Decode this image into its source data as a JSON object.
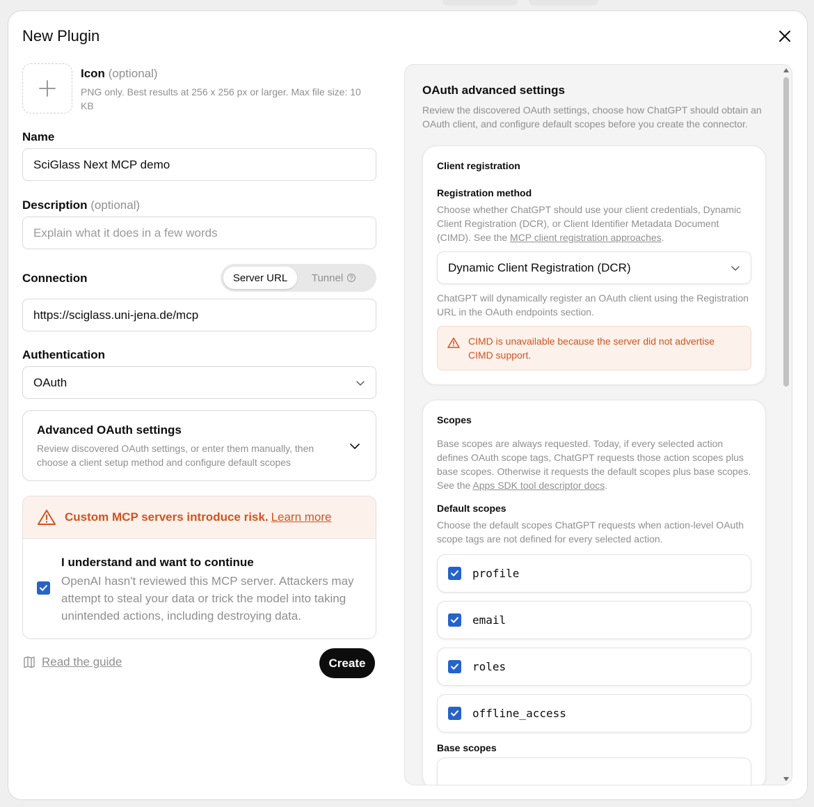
{
  "dialog": {
    "title": "New Plugin"
  },
  "icon_field": {
    "title": "Icon",
    "optional": "(optional)",
    "help": "PNG only. Best results at 256 x 256 px or larger. Max file size: 10 KB"
  },
  "name_field": {
    "label": "Name",
    "value": "SciGlass Next MCP demo"
  },
  "description_field": {
    "label": "Description",
    "optional": "(optional)",
    "placeholder": "Explain what it does in a few words"
  },
  "connection": {
    "label": "Connection",
    "options": [
      "Server URL",
      "Tunnel"
    ],
    "selected": "Server URL",
    "value": "https://sciglass.uni-jena.de/mcp"
  },
  "authentication": {
    "label": "Authentication",
    "value": "OAuth"
  },
  "advanced_oauth": {
    "title": "Advanced OAuth settings",
    "description": "Review discovered OAuth settings, or enter them manually, then choose a client setup method and configure default scopes"
  },
  "risk": {
    "headline": "Custom MCP servers introduce risk.",
    "link": "Learn more",
    "ack_title": "I understand and want to continue",
    "ack_desc": "OpenAI hasn't reviewed this MCP server. Attackers may attempt to steal your data or trick the model into taking unintended actions, including destroying data.",
    "ack_checked": true
  },
  "footer": {
    "guide": "Read the guide",
    "create": "Create"
  },
  "oauth_panel": {
    "title": "OAuth advanced settings",
    "description": "Review the discovered OAuth settings, choose how ChatGPT should obtain an OAuth client, and configure default scopes before you create the connector.",
    "client_registration": {
      "title": "Client registration",
      "method_label": "Registration method",
      "method_desc": "Choose whether ChatGPT should use your client credentials, Dynamic Client Registration (DCR), or Client Identifier Metadata Document (CIMD). See the",
      "method_link": "MCP client registration approaches",
      "method_value": "Dynamic Client Registration (DCR)",
      "method_note": "ChatGPT will dynamically register an OAuth client using the Registration URL in the OAuth endpoints section.",
      "warning": "CIMD is unavailable because the server did not advertise CIMD support."
    },
    "scopes": {
      "title": "Scopes",
      "desc": "Base scopes are always requested. Today, if every selected action defines OAuth scope tags, ChatGPT requests those action scopes plus base scopes. Otherwise it requests the default scopes plus base scopes. See the",
      "desc_link": "Apps SDK tool descriptor docs",
      "default_label": "Default scopes",
      "default_desc": "Choose the default scopes ChatGPT requests when action-level OAuth scope tags are not defined for every selected action.",
      "items": [
        {
          "name": "profile",
          "checked": true
        },
        {
          "name": "email",
          "checked": true
        },
        {
          "name": "roles",
          "checked": true
        },
        {
          "name": "offline_access",
          "checked": true
        }
      ],
      "base_label": "Base scopes"
    }
  },
  "colors": {
    "accent": "#2563c9",
    "warning": "#d1541c",
    "primary_button": "#0d0d0d"
  }
}
